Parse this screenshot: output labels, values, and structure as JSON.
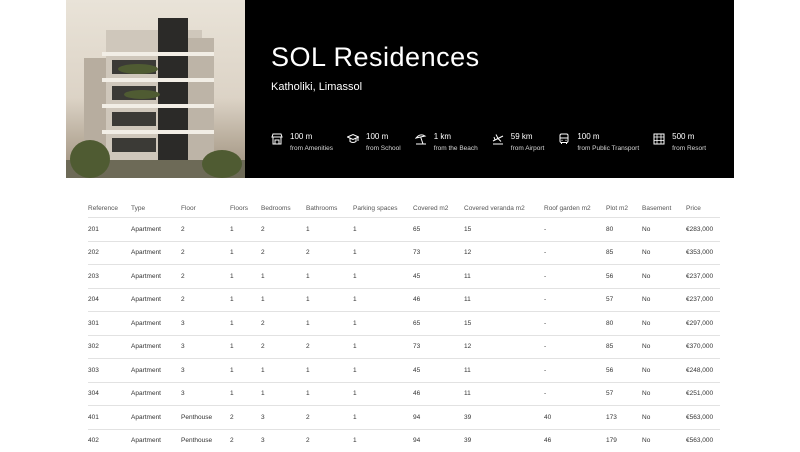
{
  "hero": {
    "title": "SOL Residences",
    "subtitle": "Katholiki, Limassol",
    "distances": [
      {
        "icon": "shop-icon",
        "value": "100 m",
        "label": "from Amenities"
      },
      {
        "icon": "school-icon",
        "value": "100 m",
        "label": "from School"
      },
      {
        "icon": "beach-umbrella-icon",
        "value": "1 km",
        "label": "from the Beach"
      },
      {
        "icon": "airplane-icon",
        "value": "59 km",
        "label": "from Airport"
      },
      {
        "icon": "bus-icon",
        "value": "100 m",
        "label": "from Public Transport"
      },
      {
        "icon": "hotel-icon",
        "value": "500 m",
        "label": "from Resort"
      }
    ]
  },
  "table": {
    "headers": [
      "Reference",
      "Type",
      "Floor",
      "Floors",
      "Bedrooms",
      "Bathrooms",
      "Parking spaces",
      "Covered m2",
      "Covered veranda m2",
      "Roof garden m2",
      "Plot m2",
      "Basement",
      "Price"
    ],
    "rows": [
      [
        "201",
        "Apartment",
        "2",
        "1",
        "2",
        "1",
        "1",
        "65",
        "15",
        "-",
        "80",
        "No",
        "€283,000"
      ],
      [
        "202",
        "Apartment",
        "2",
        "1",
        "2",
        "2",
        "1",
        "73",
        "12",
        "-",
        "85",
        "No",
        "€353,000"
      ],
      [
        "203",
        "Apartment",
        "2",
        "1",
        "1",
        "1",
        "1",
        "45",
        "11",
        "-",
        "56",
        "No",
        "€237,000"
      ],
      [
        "204",
        "Apartment",
        "2",
        "1",
        "1",
        "1",
        "1",
        "46",
        "11",
        "-",
        "57",
        "No",
        "€237,000"
      ],
      [
        "301",
        "Apartment",
        "3",
        "1",
        "2",
        "1",
        "1",
        "65",
        "15",
        "-",
        "80",
        "No",
        "€297,000"
      ],
      [
        "302",
        "Apartment",
        "3",
        "1",
        "2",
        "2",
        "1",
        "73",
        "12",
        "-",
        "85",
        "No",
        "€370,000"
      ],
      [
        "303",
        "Apartment",
        "3",
        "1",
        "1",
        "1",
        "1",
        "45",
        "11",
        "-",
        "56",
        "No",
        "€248,000"
      ],
      [
        "304",
        "Apartment",
        "3",
        "1",
        "1",
        "1",
        "1",
        "46",
        "11",
        "-",
        "57",
        "No",
        "€251,000"
      ],
      [
        "401",
        "Apartment",
        "Penthouse",
        "2",
        "3",
        "2",
        "1",
        "94",
        "39",
        "40",
        "173",
        "No",
        "€563,000"
      ],
      [
        "402",
        "Apartment",
        "Penthouse",
        "2",
        "3",
        "2",
        "1",
        "94",
        "39",
        "46",
        "179",
        "No",
        "€563,000"
      ]
    ]
  }
}
